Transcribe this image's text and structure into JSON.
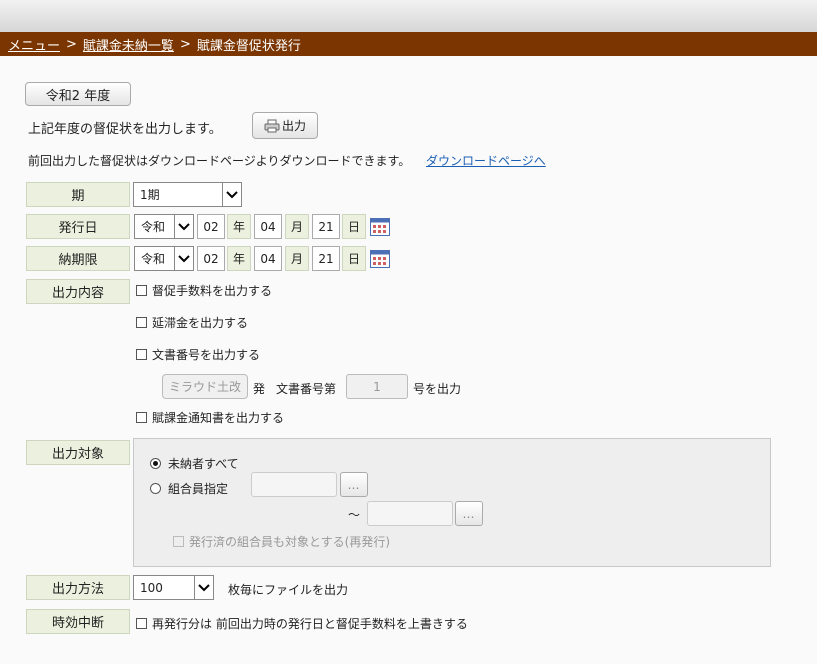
{
  "breadcrumb": {
    "menu": "メニュー",
    "sep1": ">",
    "list": "賦課金未納一覧",
    "sep2": ">",
    "current": "賦課金督促状発行"
  },
  "year_button": "令和2 年度",
  "intro": {
    "text": "上記年度の督促状を出力します。",
    "print_button": "出力"
  },
  "download": {
    "text": "前回出力した督促状はダウンロードページよりダウンロードできます。",
    "link": "ダウンロードページへ"
  },
  "period": {
    "label": "期",
    "value": "1期"
  },
  "issue_date": {
    "label": "発行日",
    "era": "令和",
    "year": "02",
    "year_unit": "年",
    "month": "04",
    "month_unit": "月",
    "day": "21",
    "day_unit": "日"
  },
  "due_date": {
    "label": "納期限",
    "era": "令和",
    "year": "02",
    "year_unit": "年",
    "month": "04",
    "month_unit": "月",
    "day": "21",
    "day_unit": "日"
  },
  "output_content": {
    "label": "出力内容",
    "opt_fee": "督促手数料を出力する",
    "opt_late": "延滞金を出力する",
    "opt_docno": "文書番号を出力する",
    "office": "ミラウド土改",
    "hatsu": "発",
    "docno_prefix": "文書番号第",
    "docno_value": "1",
    "docno_suffix": "号を出力",
    "opt_notice": "賦課金通知書を出力する"
  },
  "output_target": {
    "label": "出力対象",
    "radio_all": "未納者すべて",
    "radio_member": "組合員指定",
    "dots": "…",
    "tilde": "～",
    "reissue": "発行済の組合員も対象とする(再発行)"
  },
  "output_method": {
    "label": "出力方法",
    "value": "100",
    "suffix": "枚毎にファイルを出力"
  },
  "prescription": {
    "label": "時効中断",
    "opt": "再発行分は 前回出力時の発行日と督促手数料を上書きする"
  }
}
